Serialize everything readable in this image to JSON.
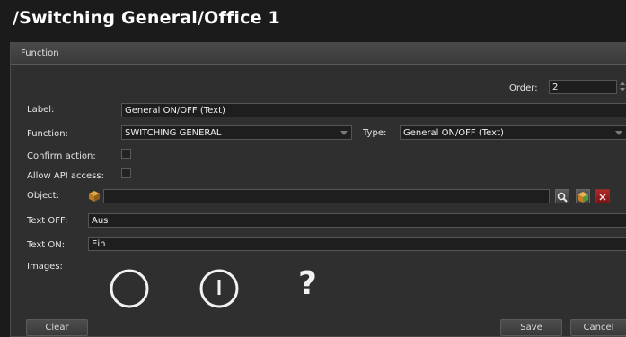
{
  "page": {
    "title": "/Switching General/Office 1"
  },
  "panel": {
    "header": "Function"
  },
  "form": {
    "order_label": "Order:",
    "order_value": "2",
    "label_label": "Label:",
    "label_value": "General ON/OFF (Text)",
    "function_label": "Function:",
    "function_value": "SWITCHING GENERAL",
    "type_label": "Type:",
    "type_value": "General ON/OFF (Text)",
    "confirm_label": "Confirm action:",
    "confirm_checked": false,
    "api_label": "Allow API access:",
    "api_checked": false,
    "object_label": "Object:",
    "object_value": "",
    "text_off_label": "Text OFF:",
    "text_off_value": "Aus",
    "text_on_label": "Text ON:",
    "text_on_value": "Ein",
    "images_label": "Images:",
    "images": [
      "circle-off-icon",
      "circle-power-icon",
      "question-mark-icon"
    ],
    "images_unknown_glyph": "?"
  },
  "buttons": {
    "clear": "Clear",
    "save": "Save",
    "cancel": "Cancel"
  },
  "colors": {
    "background": "#1b1b1b",
    "panel": "#2f2f2f",
    "field": "#1e1e1e",
    "delete_red": "#a52020",
    "object_orange": "#c9892f"
  }
}
